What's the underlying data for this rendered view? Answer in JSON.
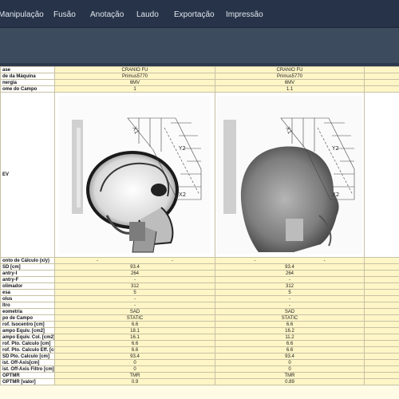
{
  "menu": [
    {
      "label": "Manipulação"
    },
    {
      "label": "Fusão"
    },
    {
      "label": "Anotação"
    },
    {
      "label": "Laudo"
    },
    {
      "label": "Exportação"
    },
    {
      "label": "Impressão"
    }
  ],
  "table": {
    "header_rows": [
      {
        "label": "ase",
        "values": [
          "CRANIO FU",
          "CRANIO FU"
        ]
      },
      {
        "label": "de da Máquina",
        "values": [
          "Primus5770",
          "Primus5770"
        ]
      },
      {
        "label": "nergia",
        "values": [
          "6MV",
          "6MV"
        ]
      },
      {
        "label": "ome do Campo",
        "values": [
          "1",
          "1.1"
        ]
      }
    ],
    "bev_label": "EV",
    "rows": [
      {
        "label": "onto de Cálculo (x/y)",
        "split": true,
        "values": [
          [
            "-",
            "-"
          ],
          [
            "-",
            "-"
          ]
        ]
      },
      {
        "label": "SD [cm]",
        "values": [
          "93.4",
          "93.4"
        ]
      },
      {
        "label": "antry-I",
        "values": [
          "264",
          "264"
        ]
      },
      {
        "label": "antry-F",
        "values": [
          "-",
          "-"
        ]
      },
      {
        "label": "olimador",
        "values": [
          "312",
          "312"
        ]
      },
      {
        "label": "esa",
        "values": [
          "5",
          "5"
        ]
      },
      {
        "label": "olus",
        "values": [
          "-",
          "-"
        ]
      },
      {
        "label": "ltro",
        "values": [
          "-",
          "-"
        ]
      },
      {
        "label": "eometria",
        "values": [
          "SAD",
          "SAD"
        ]
      },
      {
        "label": "po de Campo",
        "values": [
          "STATIC",
          "STATIC"
        ]
      },
      {
        "label": "rof. Isocentro [cm]",
        "values": [
          "6.6",
          "6.6"
        ]
      },
      {
        "label": "ampo Equiv. [cm2]",
        "values": [
          "18.1",
          "16.2"
        ]
      },
      {
        "label": "ampo Equiv. Col. [cm2]",
        "values": [
          "16.1",
          "11.2"
        ]
      },
      {
        "label": "rof. Pto. Calculo [cm]",
        "values": [
          "6.6",
          "6.6"
        ]
      },
      {
        "label": "rof. Pto. Calculo Eff. [cm]",
        "values": [
          "6.6",
          "6.6"
        ]
      },
      {
        "label": "SD Pto. Calculo [cm]",
        "values": [
          "93.4",
          "93.4"
        ]
      },
      {
        "label": "ist. Off-Axis[cm]",
        "values": [
          "0",
          "0"
        ]
      },
      {
        "label": "ist. Off-Axis Filtro [cm]",
        "values": [
          "0",
          "0"
        ]
      },
      {
        "label": "OPTMR",
        "values": [
          "TMR",
          "TMR"
        ]
      },
      {
        "label": "OPTMR [valor]",
        "values": [
          "0.9",
          "0.89"
        ]
      }
    ]
  },
  "colors": {
    "menubar": "#263348",
    "toolstrip": "#3d4b5e",
    "sheet": "#fffbe4",
    "cell": "#fff6c7"
  }
}
